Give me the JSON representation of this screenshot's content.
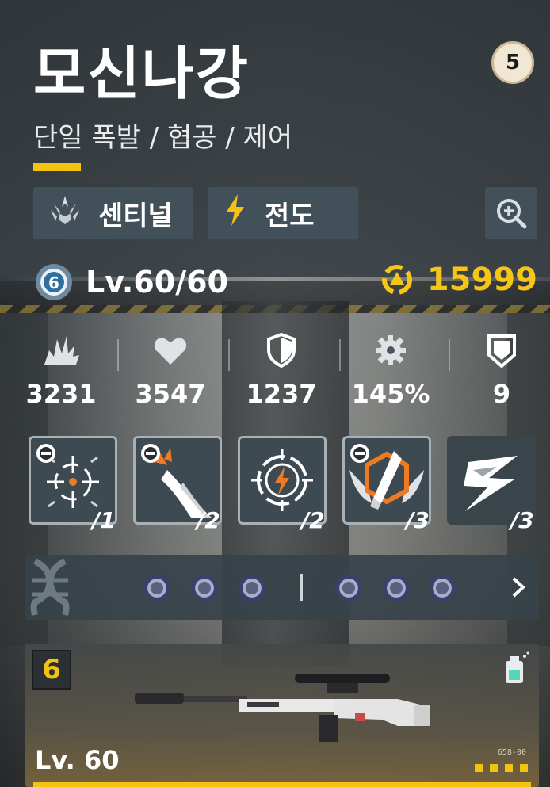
{
  "character": {
    "name": "모신나강",
    "roles": "단일 폭발 / 협공 / 제어",
    "rank_badge": "5"
  },
  "tags": [
    {
      "label": "센티널",
      "icon": "sentinel-crest-icon"
    },
    {
      "label": "전도",
      "icon": "lightning-icon"
    }
  ],
  "level": {
    "tier_badge": "6",
    "text": "Lv.60/60"
  },
  "power": {
    "value": "15999",
    "icon": "combat-power-icon"
  },
  "stats": [
    {
      "icon": "attack-burst-icon",
      "value": "3231"
    },
    {
      "icon": "heart-icon",
      "value": "3547"
    },
    {
      "icon": "shield-icon",
      "value": "1237"
    },
    {
      "icon": "gear-crit-icon",
      "value": "145%"
    },
    {
      "icon": "badge-shield-icon",
      "value": "9"
    }
  ],
  "skills": [
    {
      "icon": "crosshair-skill-icon",
      "count": "/1",
      "locked": true
    },
    {
      "icon": "slash-skill-icon",
      "count": "/2",
      "locked": true
    },
    {
      "icon": "lightning-target-skill-icon",
      "count": "/2",
      "locked": false
    },
    {
      "icon": "winged-bullet-skill-icon",
      "count": "/3",
      "locked": true
    },
    {
      "icon": "zigzag-skill-icon",
      "count": "/3",
      "locked": false
    }
  ],
  "cube_slots": {
    "icon": "dna-helix-icon",
    "left_slots": 3,
    "right_slots": 3,
    "expand_icon": "chevron-right-icon"
  },
  "weapon": {
    "rank": "6",
    "level": "Lv. 60",
    "code": "658-00",
    "stars": 4,
    "icon": "sniper-rifle-image",
    "extra_icon": "spray-can-icon"
  },
  "colors": {
    "accent": "#f3c30f",
    "panel": "#425059",
    "text": "#ffffff"
  }
}
